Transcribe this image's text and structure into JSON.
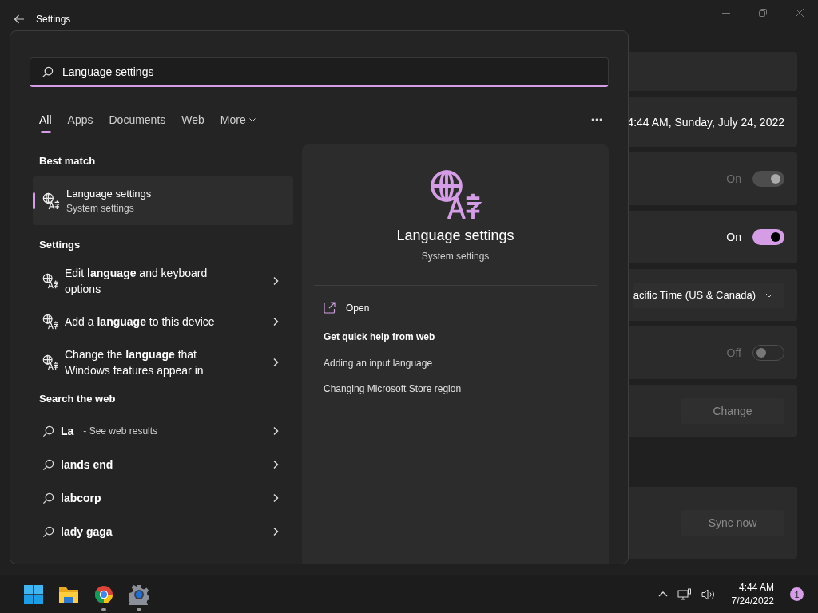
{
  "window": {
    "title": "Settings"
  },
  "settings_cards": [
    {
      "kind": "empty"
    },
    {
      "kind": "text",
      "value": "4:44 AM, Sunday, July 24, 2022"
    },
    {
      "kind": "toggle",
      "label": "On",
      "on": true,
      "disabled": true
    },
    {
      "kind": "toggle",
      "label": "On",
      "on": true,
      "disabled": false
    },
    {
      "kind": "dropdown",
      "value": "acific Time (US & Canada)"
    },
    {
      "kind": "toggle",
      "label": "Off",
      "on": false,
      "disabled": true
    },
    {
      "kind": "button",
      "label": "Change",
      "disabled": true
    }
  ],
  "sync_card": {
    "label": "Sync now",
    "disabled": true
  },
  "search": {
    "value": "Language settings"
  },
  "tabs": [
    {
      "label": "All",
      "selected": true
    },
    {
      "label": "Apps",
      "selected": false
    },
    {
      "label": "Documents",
      "selected": false
    },
    {
      "label": "Web",
      "selected": false
    }
  ],
  "more_tab": {
    "label": "More"
  },
  "best_match": {
    "heading": "Best match",
    "title": "Language settings",
    "subtitle": "System settings",
    "selected": true
  },
  "settings_results": {
    "heading": "Settings",
    "items": [
      {
        "label": "Edit **language** and keyboard options"
      },
      {
        "label": "Add a **language** to this device"
      },
      {
        "label": "Change the **language** that Windows features appear in"
      }
    ]
  },
  "web_results": {
    "heading": "Search the web",
    "items": [
      {
        "label": "La",
        "hint": "- See web results"
      },
      {
        "label": "lands end"
      },
      {
        "label": "labcorp"
      },
      {
        "label": "lady gaga"
      }
    ]
  },
  "preview": {
    "title": "Language settings",
    "subtitle": "System settings",
    "open": "Open",
    "help_heading": "Get quick help from web",
    "links": [
      "Adding an input language",
      "Changing Microsoft Store region"
    ]
  },
  "taskbar": {
    "apps": [
      {
        "kind": "start",
        "running": false
      },
      {
        "kind": "explorer",
        "running": false
      },
      {
        "kind": "browser",
        "running": true
      },
      {
        "kind": "settings",
        "running": true
      }
    ],
    "time": "4:44 AM",
    "date": "7/24/2022",
    "notifications": "1"
  }
}
